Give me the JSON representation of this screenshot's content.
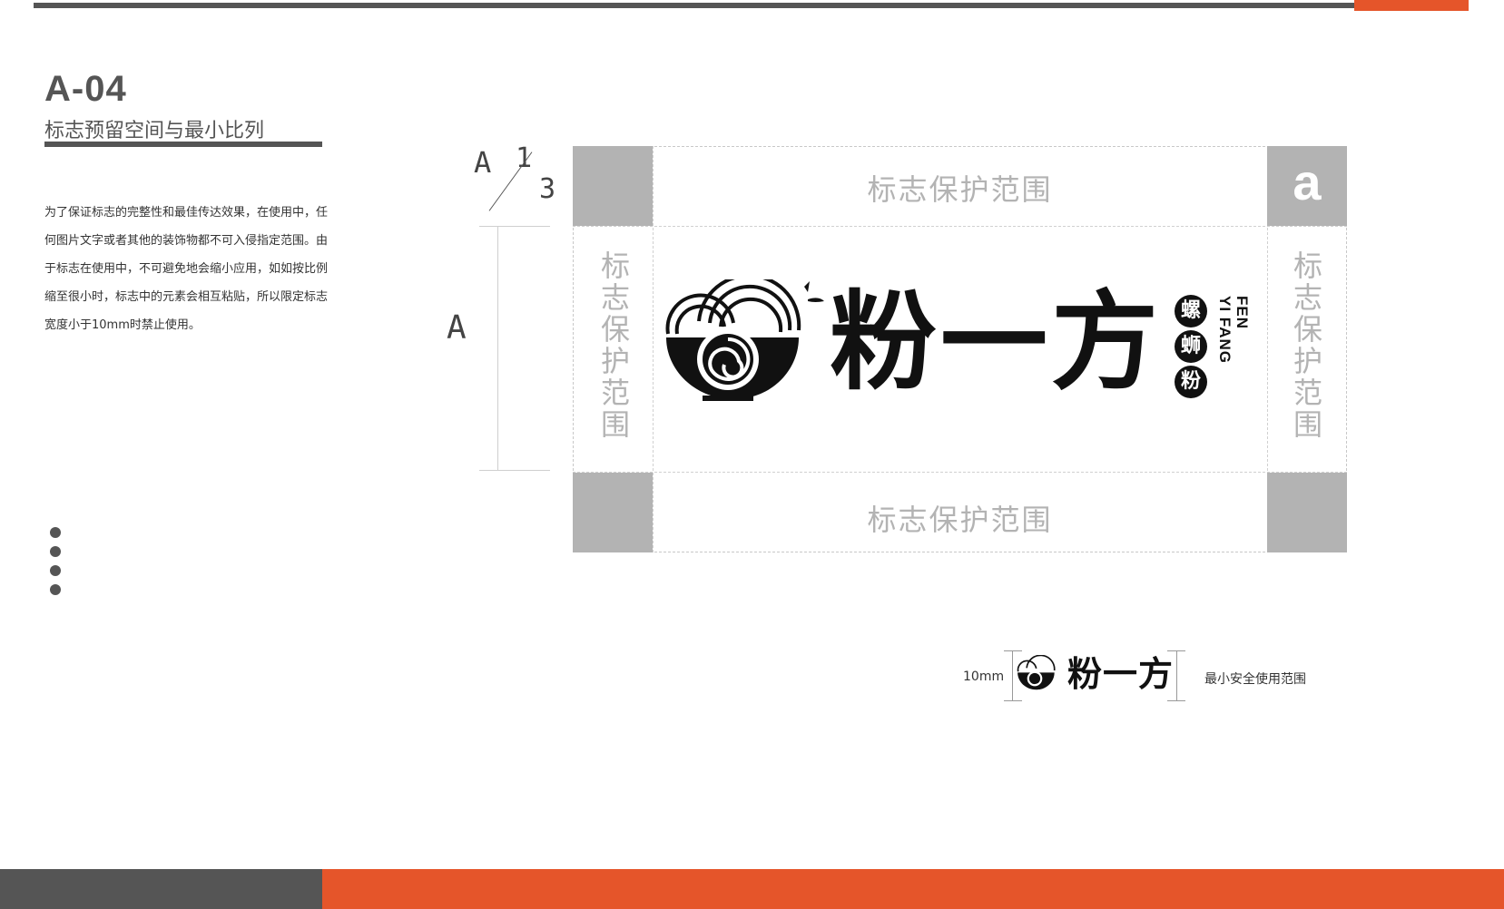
{
  "header": {
    "code": "A-04",
    "subtitle": "标志预留空间与最小比列"
  },
  "description": "为了保证标志的完整性和最佳传达效果，在使用中，任何图片文字或者其他的装饰物都不可入侵指定范围。由于标志在使用中，不可避免地会缩小应用，如如按比例缩至很小时，标志中的元素会相互粘贴，所以限定标志宽度小于10mm时禁止使用。",
  "marks": {
    "a_top": "A",
    "frac_num": "1",
    "frac_den": "3",
    "a_side": "A"
  },
  "diagram": {
    "zone_label": "标志保护范围",
    "zone_label_bottom": "标志保护范围",
    "zone_left": [
      "标",
      "志",
      "保",
      "护",
      "范",
      "围"
    ],
    "zone_right": [
      "标",
      "志",
      "保",
      "护",
      "范",
      "围"
    ],
    "corner_letter": "a"
  },
  "logo": {
    "name": "粉一方",
    "badges": [
      "螺",
      "蛳",
      "粉"
    ],
    "en_line1": "FEN",
    "en_line2": "YI FANG"
  },
  "min_size": {
    "size_label": "10mm",
    "logo_name": "粉一方",
    "caption": "最小安全使用范围"
  },
  "colors": {
    "accent": "#e5552a",
    "dark": "#555555",
    "zone_grey": "#b3b3b3"
  }
}
